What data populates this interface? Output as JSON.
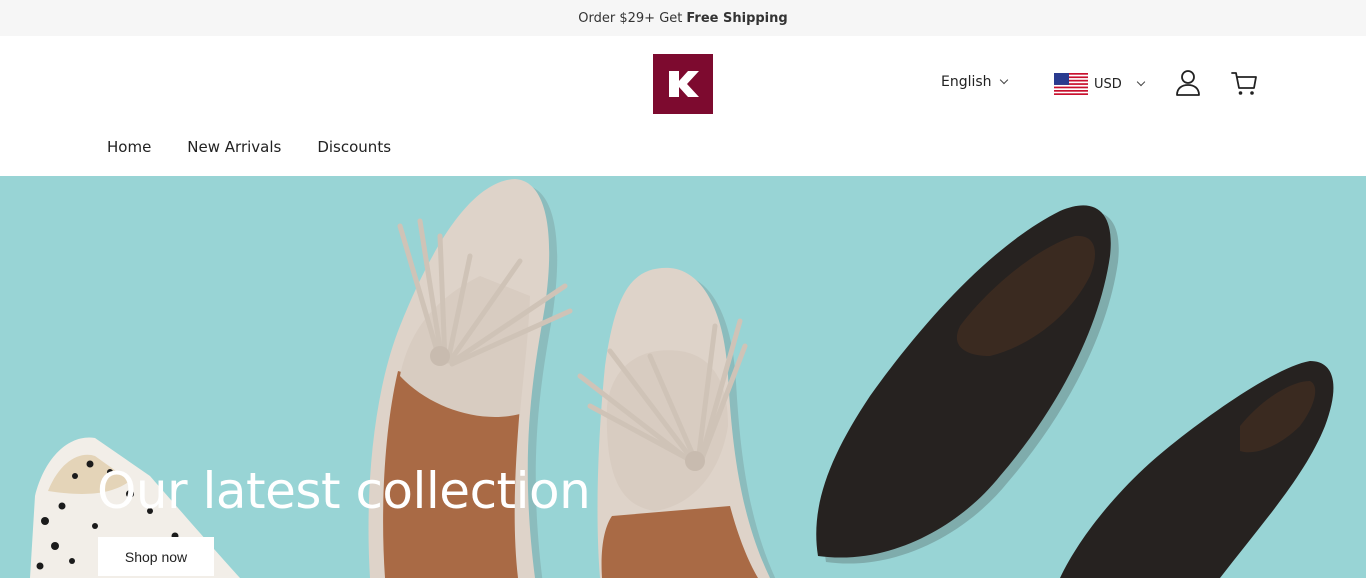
{
  "announcement": {
    "prefix": "Order $29+ Get",
    "highlight": "Free Shipping"
  },
  "header": {
    "logo_letter": "K",
    "language": "English",
    "currency": "USD",
    "icons": {
      "account": "user-icon",
      "cart": "cart-icon"
    }
  },
  "nav": {
    "items": [
      "Home",
      "New Arrivals",
      "Discounts"
    ]
  },
  "hero": {
    "title": "Our latest collection",
    "button_label": "Shop now",
    "background_color": "#98d4d5"
  },
  "colors": {
    "brand": "#7d0a2f"
  }
}
